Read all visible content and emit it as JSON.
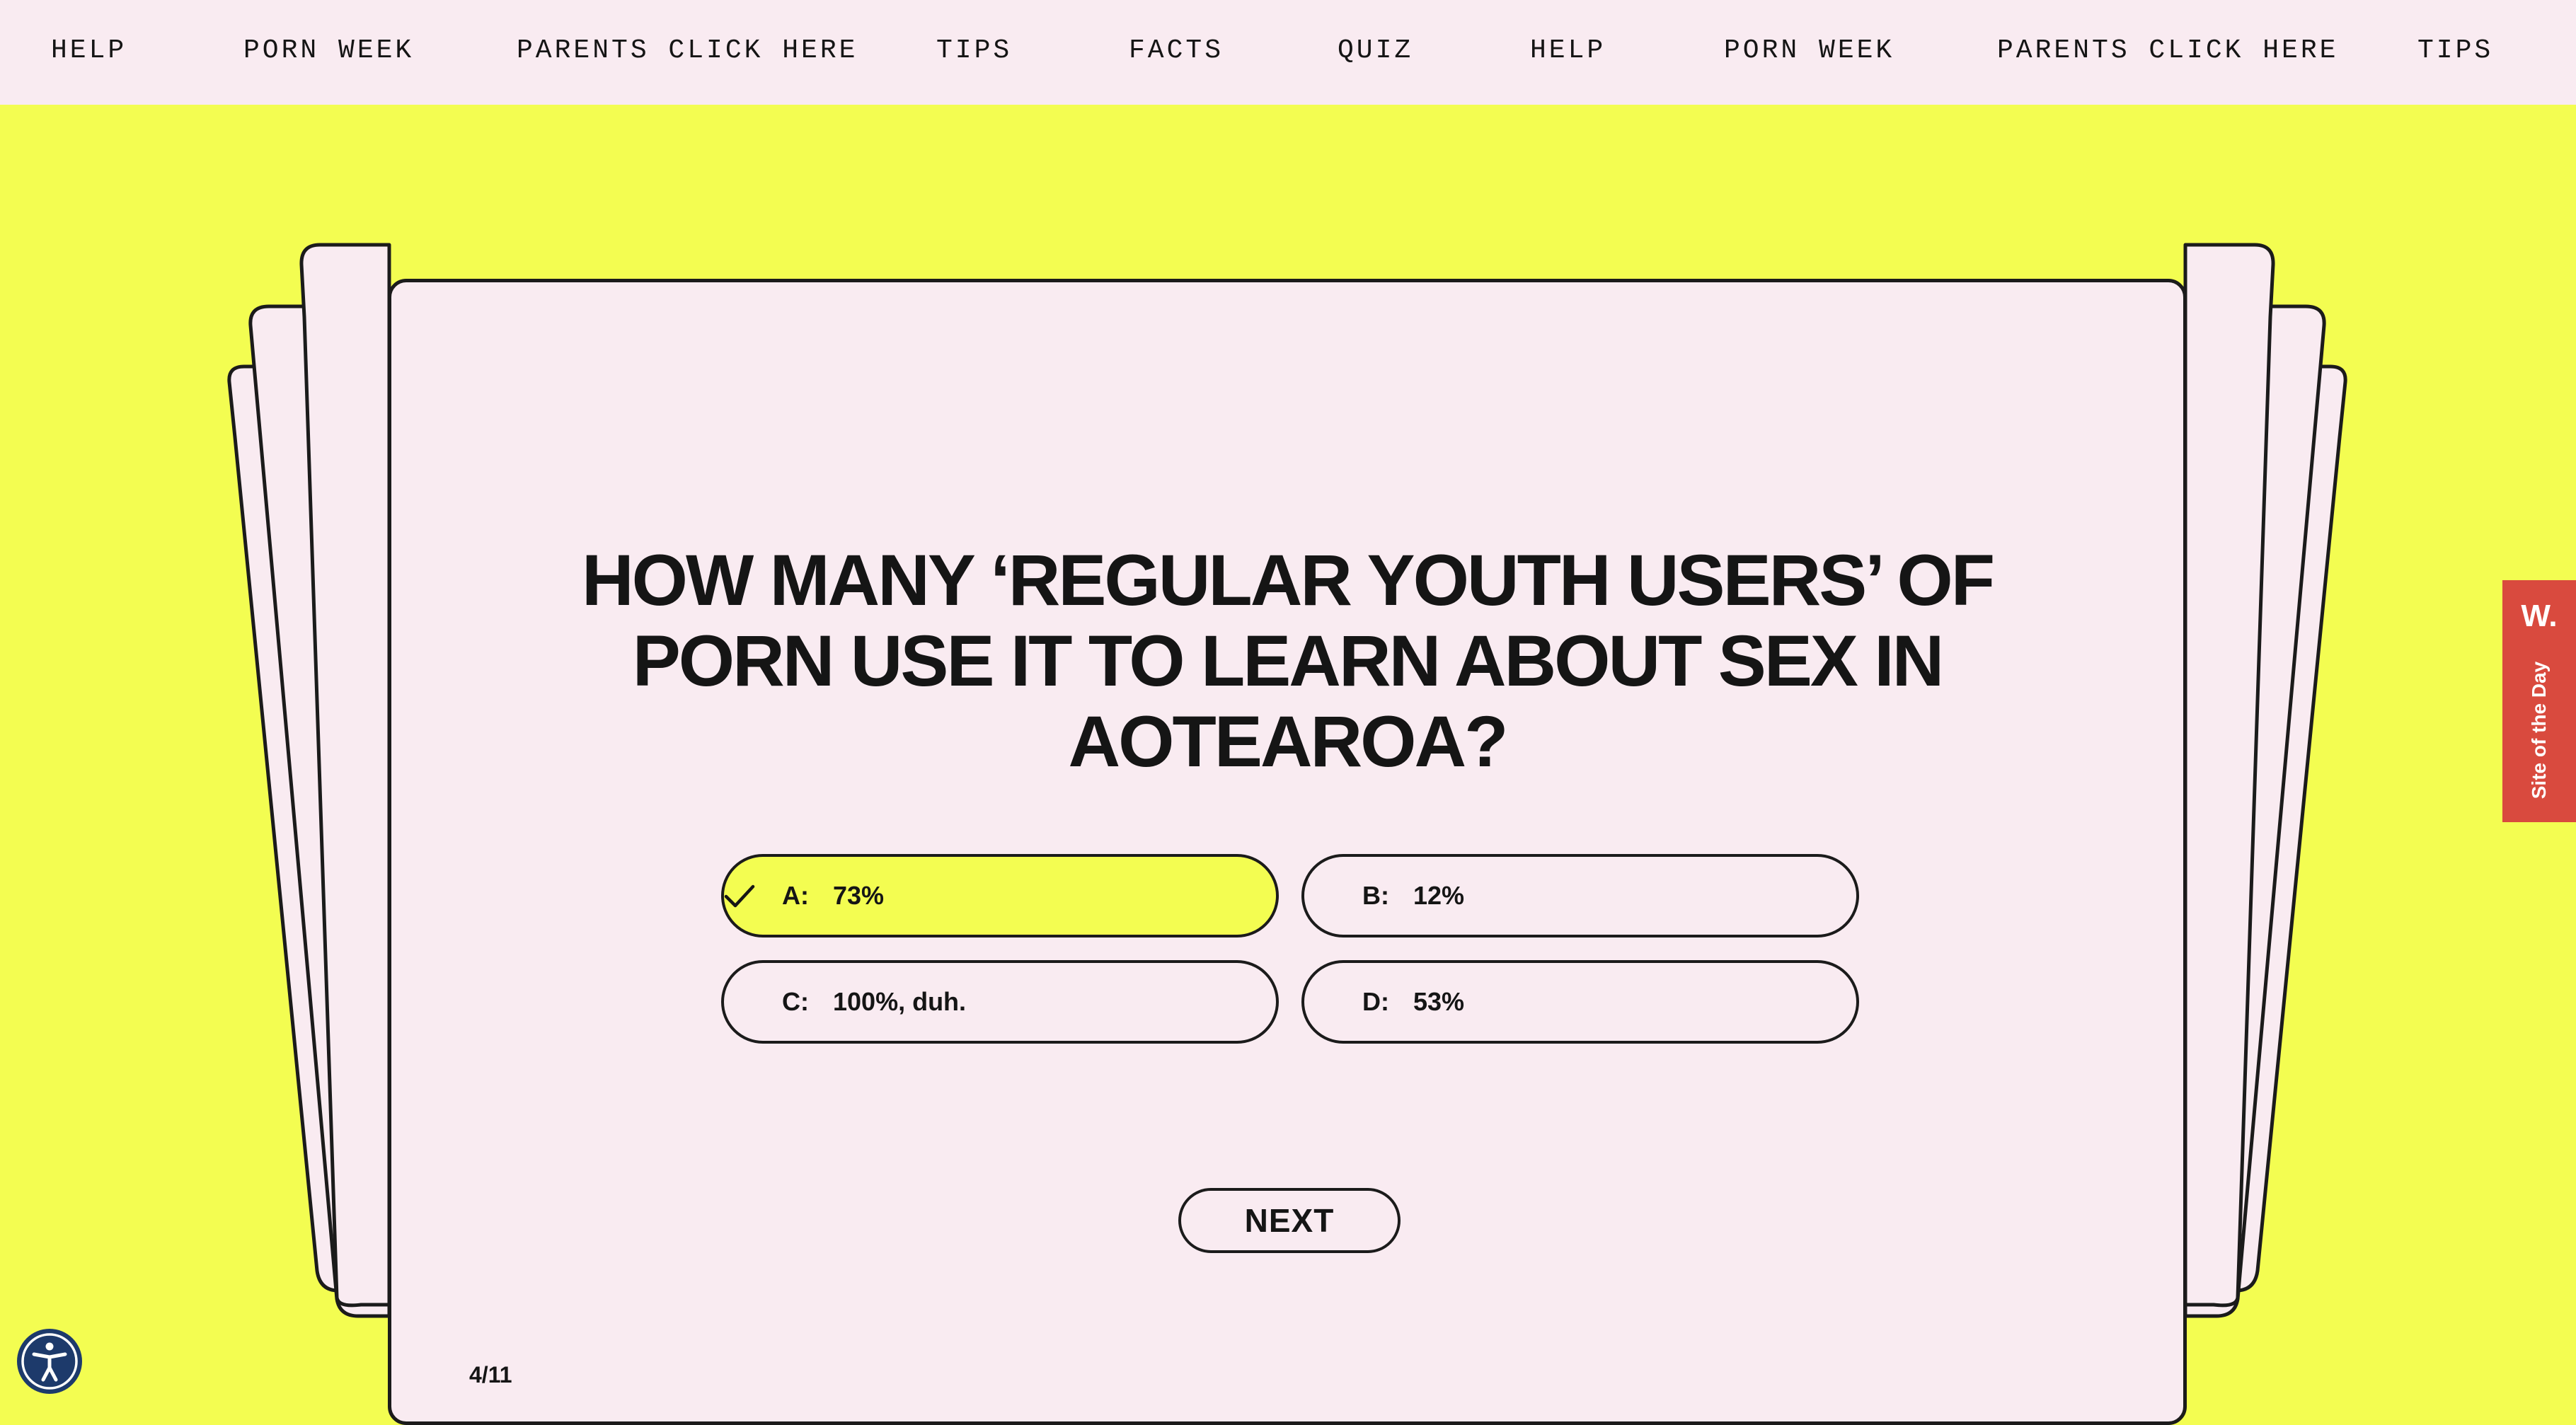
{
  "nav": {
    "items": [
      "HELP",
      "PORN WEEK",
      "PARENTS CLICK HERE",
      "TIPS",
      "FACTS",
      "QUIZ",
      "HELP",
      "PORN WEEK",
      "PARENTS CLICK HERE",
      "TIPS"
    ]
  },
  "quiz": {
    "question": "HOW MANY ‘REGULAR YOUTH USERS’ OF PORN USE IT TO LEARN ABOUT SEX IN AOTEAROA?",
    "options": [
      {
        "letter": "A:",
        "text": "73%",
        "selected": true
      },
      {
        "letter": "B:",
        "text": "12%",
        "selected": false
      },
      {
        "letter": "C:",
        "text": "100%, duh.",
        "selected": false
      },
      {
        "letter": "D:",
        "text": "53%",
        "selected": false
      }
    ],
    "next_label": "NEXT",
    "progress": "4/11"
  },
  "badge": {
    "logo": "W.",
    "label": "Site of the Day"
  },
  "icons": {
    "selected_check": "check-icon",
    "accessibility": "accessibility-icon"
  },
  "colors": {
    "background": "#f3fd51",
    "card": "#f9ebf1",
    "ink": "#151515",
    "badge": "#d94a3e",
    "accessibility": "#1d3a6b"
  }
}
